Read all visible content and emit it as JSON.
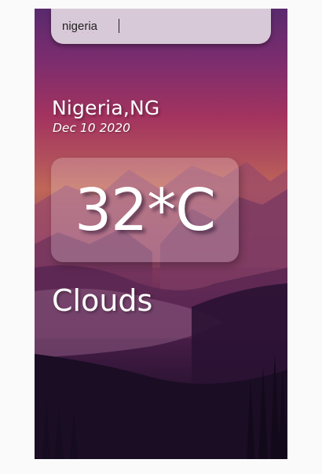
{
  "search": {
    "value": "nigeria"
  },
  "location": {
    "name": "Nigeria,NG",
    "date": "Dec 10 2020"
  },
  "weather": {
    "temperature": "32*C",
    "condition": "Clouds"
  },
  "colors": {
    "sky_top": "#5a2a6e",
    "sky_mid": "#a3335f",
    "ground": "#130b1d"
  }
}
